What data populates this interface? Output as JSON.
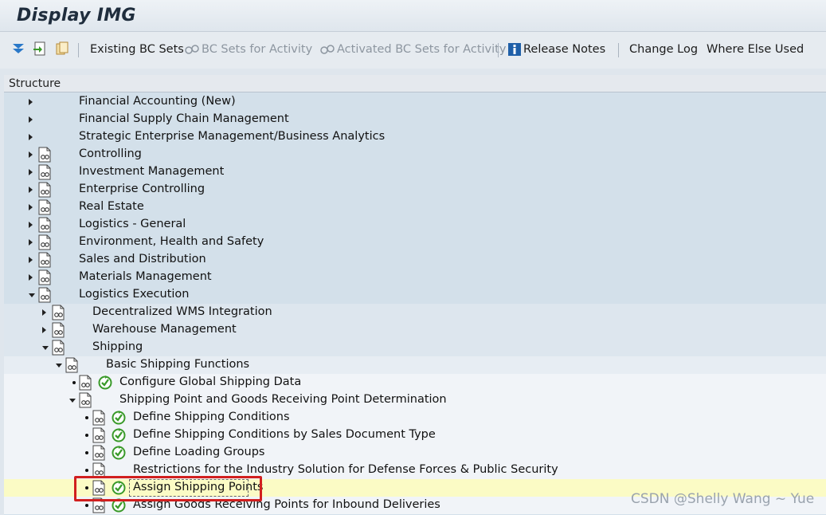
{
  "window": {
    "title": "Display IMG"
  },
  "toolbar": {
    "icons": [
      "expand-all-icon",
      "execute-icon",
      "copy-icon"
    ],
    "buttons": [
      {
        "label": "Existing BC Sets",
        "enabled": true,
        "icon": ""
      },
      {
        "label": "BC Sets for Activity",
        "enabled": false,
        "icon": "bc-sets-icon"
      },
      {
        "label": "Activated BC Sets for Activity",
        "enabled": false,
        "icon": "bc-sets-icon"
      },
      {
        "label": "Release Notes",
        "enabled": true,
        "icon": "info-icon"
      },
      {
        "label": "Change Log",
        "enabled": true,
        "icon": ""
      },
      {
        "label": "Where Else Used",
        "enabled": true,
        "icon": ""
      }
    ]
  },
  "structure": {
    "header": "Structure",
    "nodes": [
      {
        "label": "Financial Accounting (New)",
        "level": 0,
        "state": "collapsed",
        "doc": false,
        "exec": false
      },
      {
        "label": "Financial Supply Chain Management",
        "level": 0,
        "state": "collapsed",
        "doc": false,
        "exec": false
      },
      {
        "label": "Strategic Enterprise Management/Business Analytics",
        "level": 0,
        "state": "collapsed",
        "doc": false,
        "exec": false
      },
      {
        "label": "Controlling",
        "level": 0,
        "state": "collapsed",
        "doc": true,
        "exec": false
      },
      {
        "label": "Investment Management",
        "level": 0,
        "state": "collapsed",
        "doc": true,
        "exec": false
      },
      {
        "label": "Enterprise Controlling",
        "level": 0,
        "state": "collapsed",
        "doc": true,
        "exec": false
      },
      {
        "label": "Real Estate",
        "level": 0,
        "state": "collapsed",
        "doc": true,
        "exec": false
      },
      {
        "label": "Logistics - General",
        "level": 0,
        "state": "collapsed",
        "doc": true,
        "exec": false
      },
      {
        "label": "Environment, Health and Safety",
        "level": 0,
        "state": "collapsed",
        "doc": true,
        "exec": false
      },
      {
        "label": "Sales and Distribution",
        "level": 0,
        "state": "collapsed",
        "doc": true,
        "exec": false
      },
      {
        "label": "Materials Management",
        "level": 0,
        "state": "collapsed",
        "doc": true,
        "exec": false
      },
      {
        "label": "Logistics Execution",
        "level": 0,
        "state": "expanded",
        "doc": true,
        "exec": false
      },
      {
        "label": "Decentralized WMS Integration",
        "level": 1,
        "state": "collapsed",
        "doc": true,
        "exec": false
      },
      {
        "label": "Warehouse Management",
        "level": 1,
        "state": "collapsed",
        "doc": true,
        "exec": false
      },
      {
        "label": "Shipping",
        "level": 1,
        "state": "expanded",
        "doc": true,
        "exec": false
      },
      {
        "label": "Basic Shipping Functions",
        "level": 2,
        "state": "expanded",
        "doc": true,
        "exec": false
      },
      {
        "label": "Configure Global Shipping Data",
        "level": 3,
        "state": "leaf",
        "doc": true,
        "exec": true
      },
      {
        "label": "Shipping Point and Goods Receiving Point Determination",
        "level": 3,
        "state": "expanded",
        "doc": true,
        "exec": false
      },
      {
        "label": "Define Shipping Conditions",
        "level": 4,
        "state": "leaf",
        "doc": true,
        "exec": true
      },
      {
        "label": "Define Shipping Conditions by Sales Document Type",
        "level": 4,
        "state": "leaf",
        "doc": true,
        "exec": true
      },
      {
        "label": "Define Loading Groups",
        "level": 4,
        "state": "leaf",
        "doc": true,
        "exec": true
      },
      {
        "label": "Restrictions for the Industry Solution for Defense Forces & Public Security",
        "level": 4,
        "state": "leaf",
        "doc": true,
        "exec": false
      },
      {
        "label": "Assign Shipping Points",
        "level": 4,
        "state": "leaf",
        "doc": true,
        "exec": true,
        "selected": true
      },
      {
        "label": "Assign Goods Receiving Points for Inbound Deliveries",
        "level": 4,
        "state": "leaf",
        "doc": true,
        "exec": true
      }
    ]
  },
  "watermark": "CSDN @Shelly Wang ~ Yue",
  "colors": {
    "selected_row": "#fbfbc5",
    "highlight_border": "#d11f1f",
    "exec_icon": "#3a9a2a"
  }
}
